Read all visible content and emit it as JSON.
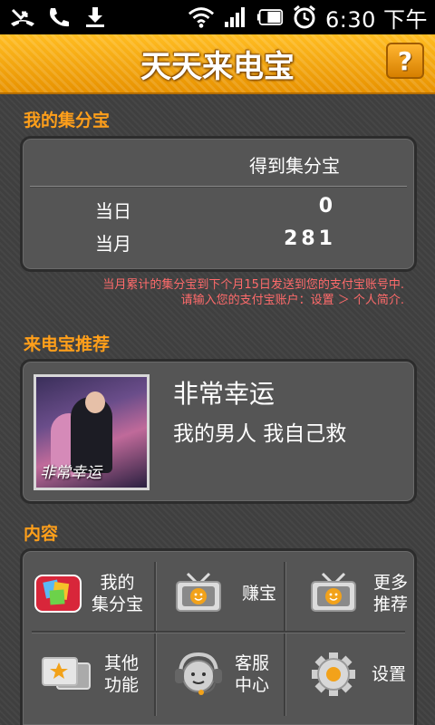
{
  "status_bar": {
    "time": "6:30 下午",
    "icons": [
      "missed-call-icon",
      "phone-icon",
      "download-icon",
      "wifi-icon",
      "signal-icon",
      "battery-icon",
      "alarm-icon"
    ]
  },
  "header": {
    "title": "天天来电宝",
    "help_label": "?"
  },
  "points": {
    "section_label": "我的集分宝",
    "column_header": "得到集分宝",
    "rows": [
      {
        "label": "当日",
        "value": "0"
      },
      {
        "label": "当月",
        "value": "281"
      }
    ],
    "notice_line1": "当月累计的集分宝到下个月15日发送到您的支付宝账号中.",
    "notice_line2": "请输入您的支付宝账户：设置 ＞ 个人简介."
  },
  "recommend": {
    "section_label": "来电宝推荐",
    "title": "非常幸运",
    "subtitle": "我的男人  我自己救",
    "poster_text": "非常幸运"
  },
  "content": {
    "section_label": "内容",
    "items": [
      {
        "label_line1": "我的",
        "label_line2": "集分宝",
        "icon": "points-icon"
      },
      {
        "label_line1": "赚宝",
        "label_line2": "",
        "icon": "tv-icon"
      },
      {
        "label_line1": "更多",
        "label_line2": "推荐",
        "icon": "tv-icon"
      },
      {
        "label_line1": "其他",
        "label_line2": "功能",
        "icon": "star-cards-icon"
      },
      {
        "label_line1": "客服",
        "label_line2": "中心",
        "icon": "headset-icon"
      },
      {
        "label_line1": "设置",
        "label_line2": "",
        "icon": "gear-icon"
      }
    ]
  },
  "colors": {
    "accent": "#ff9f1a",
    "header_bg": "#f0a300",
    "notice": "#ff6b6b",
    "panel_bg": "#555555"
  }
}
